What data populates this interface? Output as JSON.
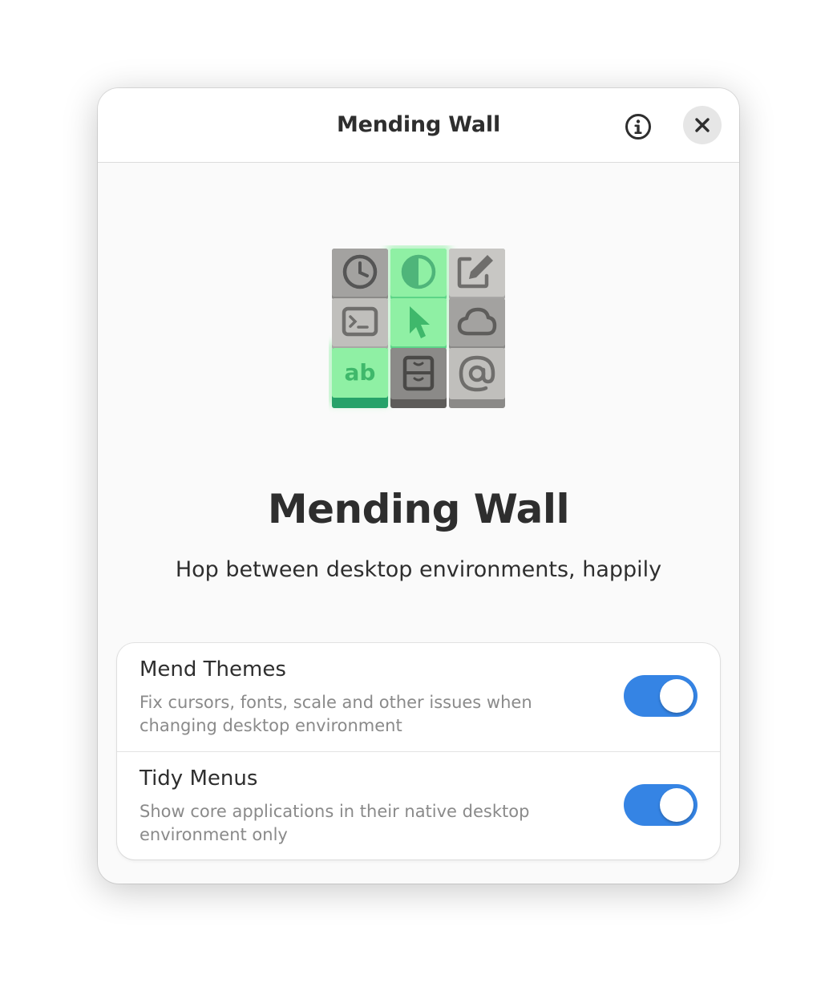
{
  "window": {
    "title": "Mending Wall"
  },
  "headerbar": {
    "about_icon": "info-icon",
    "close_icon": "close-icon"
  },
  "app": {
    "name": "Mending Wall",
    "tagline": "Hop between desktop environments, happily",
    "icon": "mending-wall-app-icon"
  },
  "preferences": [
    {
      "title": "Mend Themes",
      "subtitle": "Fix cursors, fonts, scale and other issues when changing desktop environment",
      "enabled": true
    },
    {
      "title": "Tidy Menus",
      "subtitle": "Show core applications in their native desktop environment only",
      "enabled": true
    }
  ],
  "colors": {
    "accent": "#3584e4",
    "tile_green": "#8ff0a4",
    "tile_green_dark": "#26a269",
    "tile_gray": "#9a9996",
    "tile_gray_light": "#c0bfbc",
    "text_primary": "#2e2e2e",
    "text_dim": "#8a8a8a"
  }
}
